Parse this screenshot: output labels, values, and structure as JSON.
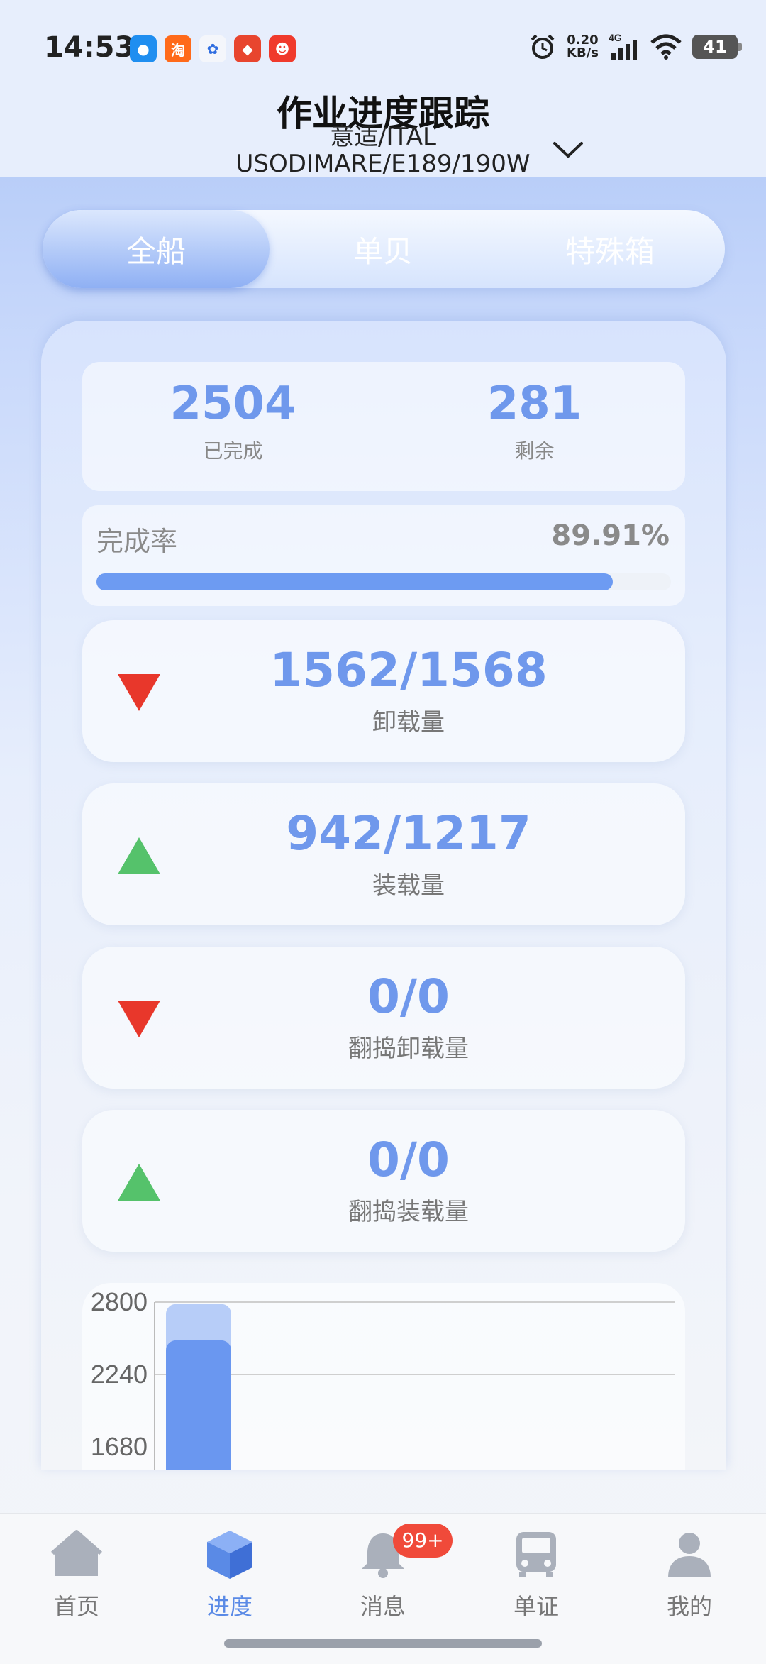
{
  "status_bar": {
    "time": "14:53",
    "net_speed_top": "0.20",
    "net_speed_bottom": "KB/s",
    "network": "4G",
    "battery": "41",
    "app_icons": [
      "qq-browser-icon",
      "taobao-icon",
      "baidu-icon",
      "app-icon",
      "app-icon-2"
    ]
  },
  "header": {
    "title": "作业进度跟踪",
    "vessel_line1": "意适/ITAL",
    "vessel_line2": "USODIMARE/E189/190W"
  },
  "tabs": [
    "全船",
    "单贝",
    "特殊箱"
  ],
  "summary": {
    "completed_value": "2504",
    "completed_label": "已完成",
    "remaining_value": "281",
    "remaining_label": "剩余"
  },
  "rate": {
    "label": "完成率",
    "value": "89.91%",
    "fraction": 0.8991
  },
  "stats": [
    {
      "value": "1562/1568",
      "label": "卸载量",
      "direction": "down",
      "color": "#e8372b"
    },
    {
      "value": "942/1217",
      "label": "装载量",
      "direction": "up",
      "color": "#55c26b"
    },
    {
      "value": "0/0",
      "label": "翻捣卸载量",
      "direction": "down",
      "color": "#e8372b"
    },
    {
      "value": "0/0",
      "label": "翻捣装载量",
      "direction": "up",
      "color": "#55c26b"
    }
  ],
  "chart_data": {
    "type": "bar",
    "y_ticks": [
      "2800",
      "2240",
      "1680"
    ],
    "ylim": [
      1680,
      2800
    ],
    "series": [
      {
        "values": [
          2785
        ]
      },
      {
        "values": [
          2504
        ]
      }
    ],
    "colors": [
      "#b7cdf8",
      "#6a97f0"
    ]
  },
  "bottom_nav": [
    {
      "label": "首页",
      "icon": "home-icon"
    },
    {
      "label": "进度",
      "icon": "cube-icon"
    },
    {
      "label": "消息",
      "icon": "bell-icon",
      "badge": "99+"
    },
    {
      "label": "单证",
      "icon": "bus-icon"
    },
    {
      "label": "我的",
      "icon": "profile-icon"
    }
  ],
  "active_nav": 1
}
